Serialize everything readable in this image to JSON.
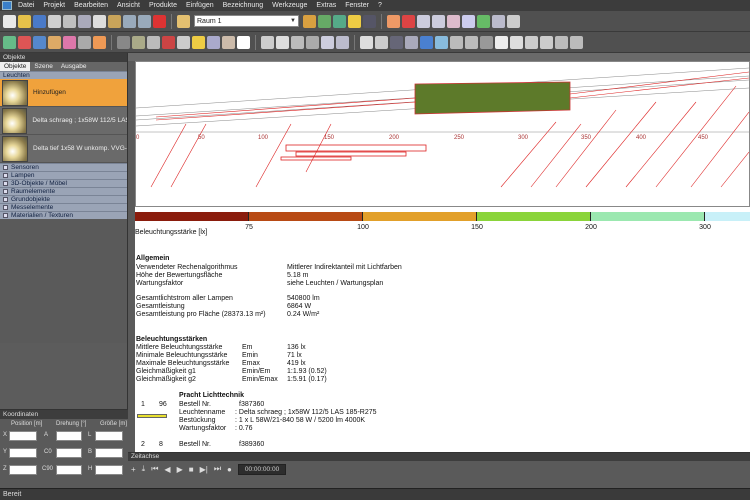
{
  "menubar": {
    "items": [
      "Datei",
      "Projekt",
      "Bearbeiten",
      "Ansicht",
      "Produkte",
      "Einfügen",
      "Bezeichnung",
      "Werkzeuge",
      "Extras",
      "Fenster",
      "?"
    ]
  },
  "toolbar": {
    "room_select": "Raum 1"
  },
  "left_panel": {
    "title": "Objekte",
    "tabs": [
      "Objekte",
      "Szene",
      "Ausgabe"
    ],
    "section_leuchten": "Leuchten",
    "luminaires": [
      {
        "label": "Hinzufügen"
      },
      {
        "label": "Delta schraeg ; 1x58W 112/5 LAS"
      },
      {
        "label": "Delta tief 1x58 W unkomp. VVG-"
      }
    ],
    "sections": [
      "Sensoren",
      "Lampen",
      "3D-Objekte / Möbel",
      "Raumelemente",
      "Grundobjekte",
      "Messelemente",
      "Materialien / Texturen"
    ]
  },
  "coordinates": {
    "title": "Koordinaten",
    "col_position": "Position [m]",
    "col_rotation": "Drehung [°]",
    "col_size": "Größe [m]",
    "rows": [
      {
        "axis": "X",
        "rot": "A",
        "size": "L"
      },
      {
        "axis": "Y",
        "rot": "C0",
        "size": "B"
      },
      {
        "axis": "Z",
        "rot": "C90",
        "size": "H"
      }
    ]
  },
  "viewport": {
    "ruler_ticks": [
      "0",
      "50",
      "100",
      "150",
      "200",
      "250",
      "300",
      "350",
      "400",
      "450"
    ]
  },
  "report": {
    "scale_numbers": [
      "75",
      "100",
      "150",
      "200",
      "300"
    ],
    "scale_unit": "Beleuchtungsstärke [lx]",
    "colors": [
      "#8a1c0c",
      "#b84a14",
      "#e2a02a",
      "#8ad43a",
      "#9be8b0",
      "#c8f0f8"
    ],
    "general_title": "Allgemein",
    "general": [
      {
        "label": "Verwendeter Rechenalgorithmus",
        "value": "Mittlerer Indirektanteil mit Lichtfarben"
      },
      {
        "label": "Höhe der Bewertungsfläche",
        "value": "5.18 m"
      },
      {
        "label": "Wartungsfaktor",
        "value": "siehe Leuchten / Wartungsplan"
      }
    ],
    "power": [
      {
        "label": "Gesamtlichtstrom aller Lampen",
        "value": "540800 lm"
      },
      {
        "label": "Gesamtleistung",
        "value": "6864 W"
      },
      {
        "label": "Gesamtleistung pro Fläche (28373.13 m²)",
        "value": "0.24 W/m²"
      }
    ],
    "illum_title": "Beleuchtungsstärken",
    "illum": [
      {
        "label": "Mittlere Beleuchtungsstärke",
        "sym": "Em",
        "value": "136 lx"
      },
      {
        "label": "Minimale Beleuchtungsstärke",
        "sym": "Emin",
        "value": "71 lx"
      },
      {
        "label": "Maximale Beleuchtungsstärke",
        "sym": "Emax",
        "value": "419 lx"
      },
      {
        "label": "Gleichmäßigkeit g1",
        "sym": "Emin/Em",
        "value": "1:1.93 (0.52)"
      },
      {
        "label": "Gleichmäßigkeit g2",
        "sym": "Emin/Emax",
        "value": "1:5.91 (0.17)"
      }
    ],
    "manufacturer": "Pracht Lichttechnik",
    "entries": [
      {
        "num": "1",
        "qty": "96",
        "bestell_label": "Bestell Nr.",
        "bestell": "f387360",
        "name_label": "Leuchtenname",
        "name": ": Delta schraeg ; 1x58W 112/5 LAS 185-R275",
        "equip_label": "Bestückung",
        "equip": ": 1 x L 58W/21-840 58 W / 5200 lm 4000K",
        "maint_label": "Wartungsfaktor",
        "maint": ": 0.76"
      },
      {
        "num": "2",
        "qty": "8",
        "bestell_label": "Bestell Nr.",
        "bestell": "f389360"
      }
    ]
  },
  "timeline": {
    "title": "Zeitachse",
    "time": "00:00:00:00"
  },
  "status": {
    "text": "Bereit"
  }
}
